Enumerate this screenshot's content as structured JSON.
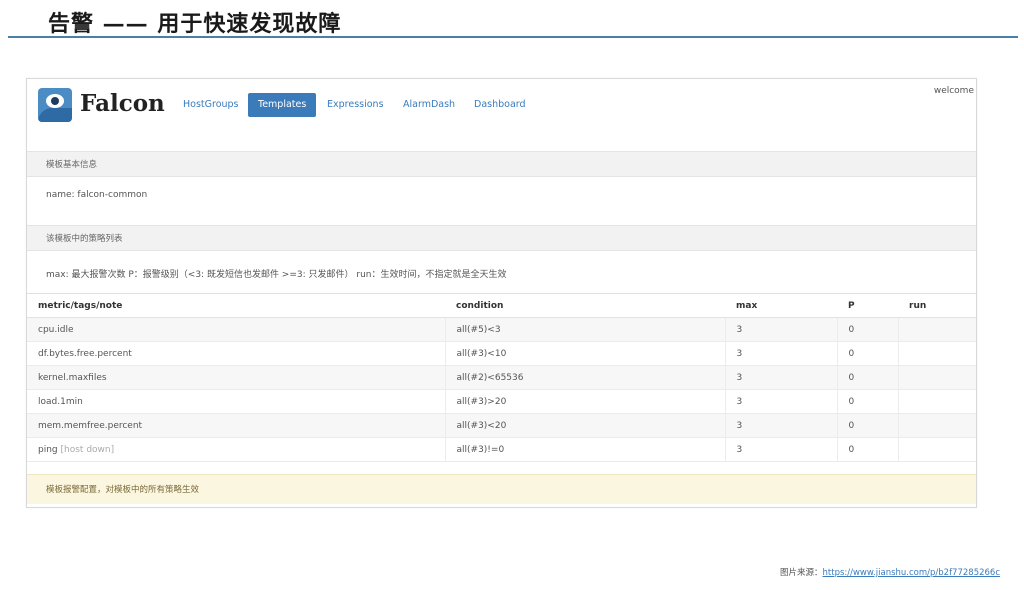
{
  "slide": {
    "title": "告警 —— 用于快速发现故障",
    "source_prefix": "图片来源：",
    "source_link": "https://www.jianshu.com/p/b2f77285266c"
  },
  "app": {
    "brand": "Falcon",
    "welcome": "welcome",
    "nav": [
      {
        "label": "HostGroups",
        "active": false
      },
      {
        "label": "Templates",
        "active": true
      },
      {
        "label": "Expressions",
        "active": false
      },
      {
        "label": "AlarmDash",
        "active": false
      },
      {
        "label": "Dashboard",
        "active": false
      }
    ]
  },
  "template_info": {
    "header": "模板基本信息",
    "name_line": "name: falcon-common"
  },
  "strategies": {
    "header": "该模板中的策略列表",
    "legend": "max: 最大报警次数 P：报警级别（<3: 既发短信也发邮件 >=3: 只发邮件） run：生效时间，不指定就是全天生效",
    "columns": [
      "metric/tags/note",
      "condition",
      "max",
      "P",
      "run"
    ],
    "rows": [
      {
        "metric": "cpu.idle",
        "tag": "",
        "condition": "all(#5)<3",
        "max": "3",
        "p": "0",
        "run": ""
      },
      {
        "metric": "df.bytes.free.percent",
        "tag": "",
        "condition": "all(#3)<10",
        "max": "3",
        "p": "0",
        "run": ""
      },
      {
        "metric": "kernel.maxfiles",
        "tag": "",
        "condition": "all(#2)<65536",
        "max": "3",
        "p": "0",
        "run": ""
      },
      {
        "metric": "load.1min",
        "tag": "",
        "condition": "all(#3)>20",
        "max": "3",
        "p": "0",
        "run": ""
      },
      {
        "metric": "mem.memfree.percent",
        "tag": "",
        "condition": "all(#3)<20",
        "max": "3",
        "p": "0",
        "run": ""
      },
      {
        "metric": "ping",
        "tag": "[host down]",
        "condition": "all(#3)!=0",
        "max": "3",
        "p": "0",
        "run": ""
      }
    ]
  },
  "alarm_config": {
    "label": "模板报警配置，对模板中的所有策略生效"
  }
}
